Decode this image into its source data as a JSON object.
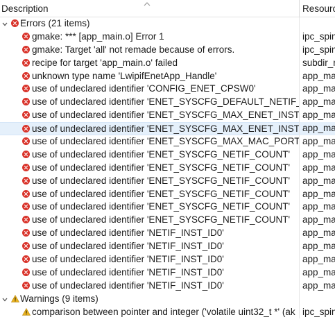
{
  "header": {
    "description": "Description",
    "resource": "Resource"
  },
  "errors_group": {
    "label": "Errors (21 items)",
    "items": [
      {
        "description": "gmake: *** [app_main.o] Error 1",
        "resource": "ipc_spin"
      },
      {
        "description": "gmake: Target 'all' not remade because of errors.",
        "resource": "ipc_spin"
      },
      {
        "description": "recipe for target 'app_main.o' failed",
        "resource": "subdir_r"
      },
      {
        "description": "unknown type name 'LwipifEnetApp_Handle'",
        "resource": "app_ma"
      },
      {
        "description": "use of undeclared identifier 'CONFIG_ENET_CPSW0'",
        "resource": "app_ma"
      },
      {
        "description": "use of undeclared identifier 'ENET_SYSCFG_DEFAULT_NETIF_IDX'",
        "resource": "app_ma"
      },
      {
        "description": "use of undeclared identifier 'ENET_SYSCFG_MAX_ENET_INSTANC",
        "resource": "app_ma"
      },
      {
        "description": "use of undeclared identifier 'ENET_SYSCFG_MAX_ENET_INSTANC",
        "resource": "app_ma"
      },
      {
        "description": "use of undeclared identifier 'ENET_SYSCFG_MAX_MAC_PORTS'",
        "resource": "app_ma"
      },
      {
        "description": "use of undeclared identifier 'ENET_SYSCFG_NETIF_COUNT'",
        "resource": "app_ma"
      },
      {
        "description": "use of undeclared identifier 'ENET_SYSCFG_NETIF_COUNT'",
        "resource": "app_ma"
      },
      {
        "description": "use of undeclared identifier 'ENET_SYSCFG_NETIF_COUNT'",
        "resource": "app_ma"
      },
      {
        "description": "use of undeclared identifier 'ENET_SYSCFG_NETIF_COUNT'",
        "resource": "app_ma"
      },
      {
        "description": "use of undeclared identifier 'ENET_SYSCFG_NETIF_COUNT'",
        "resource": "app_ma"
      },
      {
        "description": "use of undeclared identifier 'ENET_SYSCFG_NETIF_COUNT'",
        "resource": "app_ma"
      },
      {
        "description": "use of undeclared identifier 'NETIF_INST_ID0'",
        "resource": "app_ma"
      },
      {
        "description": "use of undeclared identifier 'NETIF_INST_ID0'",
        "resource": "app_ma"
      },
      {
        "description": "use of undeclared identifier 'NETIF_INST_ID0'",
        "resource": "app_ma"
      },
      {
        "description": "use of undeclared identifier 'NETIF_INST_ID0'",
        "resource": "app_ma"
      },
      {
        "description": "use of undeclared identifier 'NETIF_INST_ID0'",
        "resource": "app_ma"
      }
    ]
  },
  "warnings_group": {
    "label": "Warnings (9 items)",
    "items": [
      {
        "description": "comparison between pointer and integer ('volatile uint32_t *' (ak",
        "resource": "ipc_spin"
      }
    ]
  },
  "selected_error_index": 7,
  "colors": {
    "error": "#d9342b",
    "warning": "#e8b21f",
    "selection": "#e5f0fb"
  },
  "icons": {
    "group_toggle": "chevron-down-icon",
    "error": "error-icon",
    "warning": "warning-icon",
    "sort": "sort-ascending-icon"
  }
}
